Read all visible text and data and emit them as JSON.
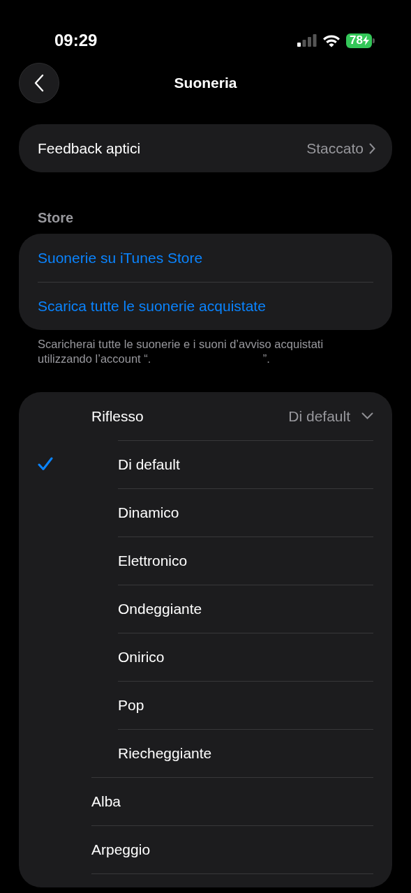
{
  "status_bar": {
    "time": "09:29",
    "battery": "78"
  },
  "nav": {
    "title": "Suoneria"
  },
  "haptics": {
    "label": "Feedback aptici",
    "value": "Staccato"
  },
  "store": {
    "header": "Store",
    "links": [
      "Suonerie su iTunes Store",
      "Scarica tutte le suonerie acquistate"
    ],
    "footer": "Scaricherai tutte le suonerie e i suoni d’avviso acquistati utilizzando l’account “.                                   ”."
  },
  "sounds": [
    {
      "name": "Riflesso",
      "value": "Di default",
      "expanded": true,
      "selected": false,
      "children": [
        {
          "name": "Di default",
          "selected": true
        },
        {
          "name": "Dinamico",
          "selected": false
        },
        {
          "name": "Elettronico",
          "selected": false
        },
        {
          "name": "Ondeggiante",
          "selected": false
        },
        {
          "name": "Onirico",
          "selected": false
        },
        {
          "name": "Pop",
          "selected": false
        },
        {
          "name": "Riecheggiante",
          "selected": false
        }
      ]
    },
    {
      "name": "Alba",
      "selected": false
    },
    {
      "name": "Arpeggio",
      "selected": false
    }
  ]
}
